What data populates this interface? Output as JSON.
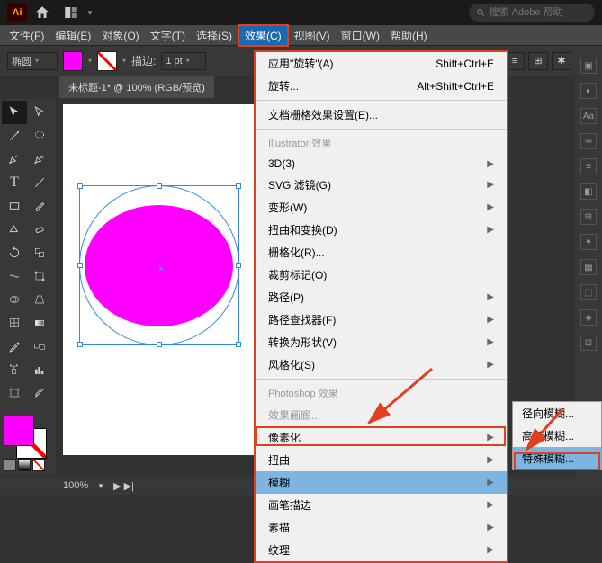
{
  "tab": {
    "search_placeholder": "搜索 Adobe 帮助"
  },
  "menubar": {
    "file": "文件(F)",
    "edit": "编辑(E)",
    "object": "对象(O)",
    "type": "文字(T)",
    "select": "选择(S)",
    "effect": "效果(C)",
    "view": "视图(V)",
    "window": "窗口(W)",
    "help": "帮助(H)"
  },
  "ctrl": {
    "shape": "椭圆",
    "stroke_label": "描边:",
    "pt": "1 pt"
  },
  "doc_title": "未标题-1* @ 100% (RGB/预览)",
  "menu": {
    "apply": "应用\"旋转\"(A)",
    "apply_sc": "Shift+Ctrl+E",
    "rotate": "旋转...",
    "rotate_sc": "Alt+Shift+Ctrl+E",
    "doc_raster": "文档栅格效果设置(E)...",
    "hdr_ill": "Illustrator 效果",
    "i3d": "3D(3)",
    "svg": "SVG 滤镜(G)",
    "warp": "变形(W)",
    "distort": "扭曲和变换(D)",
    "raster": "栅格化(R)...",
    "crop": "裁剪标记(O)",
    "path": "路径(P)",
    "pathfinder": "路径查找器(F)",
    "convert": "转换为形状(V)",
    "stylize": "风格化(S)",
    "hdr_ps": "Photoshop 效果",
    "gallery": "效果画廊...",
    "pixelate": "像素化",
    "distort2": "扭曲",
    "blur": "模糊",
    "brush": "画笔描边",
    "sketch": "素描",
    "texture": "纹理"
  },
  "submenu": {
    "radial": "径向模糊...",
    "gauss": "高斯模糊...",
    "smart": "特殊模糊..."
  },
  "status": {
    "zoom": "100%",
    "nav": "▶ ▶|"
  }
}
